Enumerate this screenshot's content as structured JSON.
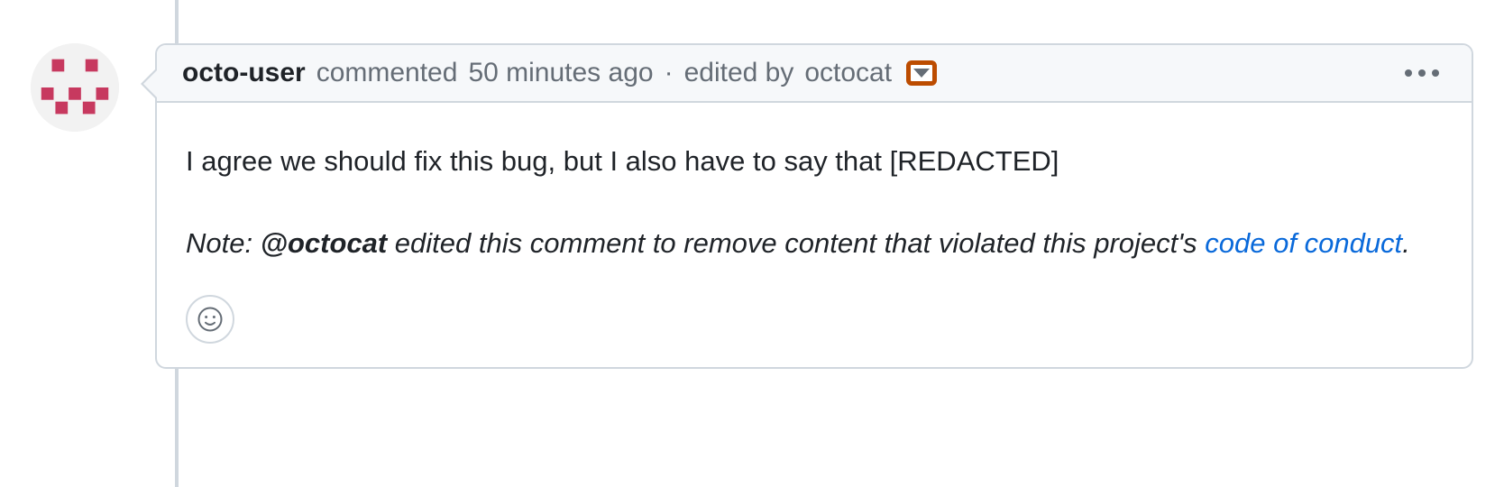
{
  "comment": {
    "author": "octo-user",
    "action": "commented",
    "timestamp": "50 minutes ago",
    "separator": "·",
    "edited_prefix": "edited by",
    "edited_by": "octocat",
    "body_text": "I agree we should fix this bug, but I also have to say that [REDACTED]",
    "note_prefix": "Note: ",
    "note_mention": "@octocat",
    "note_mid": " edited this comment to remove content that violated this project's ",
    "note_link": "code of conduct",
    "note_suffix": "."
  }
}
